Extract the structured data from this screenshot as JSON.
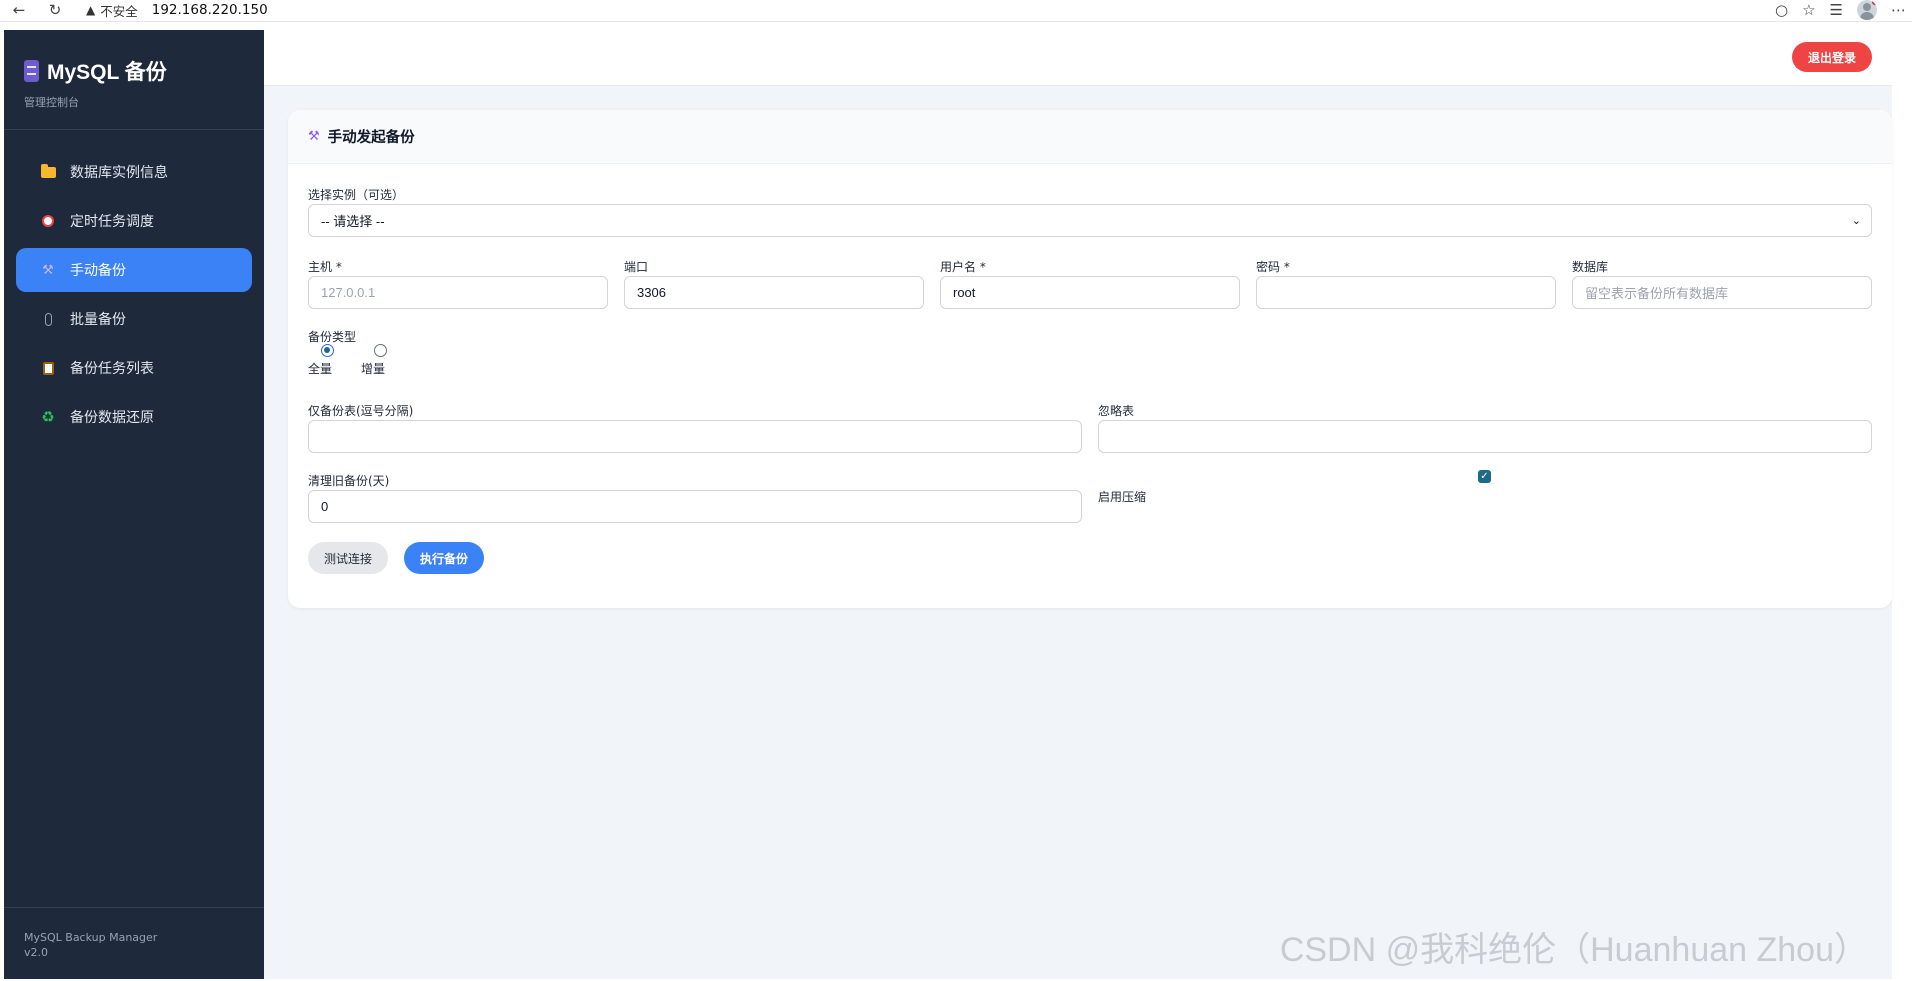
{
  "browser": {
    "insecure_label": "不安全",
    "url": "192.168.220.150"
  },
  "sidebar": {
    "brand_title": "MySQL 备份",
    "brand_subtitle": "管理控制台",
    "items": [
      {
        "label": "数据库实例信息",
        "icon": "folder-icon"
      },
      {
        "label": "定时任务调度",
        "icon": "alarm-clock-icon"
      },
      {
        "label": "手动备份",
        "icon": "tools-icon",
        "active": true
      },
      {
        "label": "批量备份",
        "icon": "paperclip-icon"
      },
      {
        "label": "备份任务列表",
        "icon": "clipboard-icon"
      },
      {
        "label": "备份数据还原",
        "icon": "recycle-icon"
      }
    ],
    "footer_name": "MySQL Backup Manager",
    "footer_version": "v2.0"
  },
  "topbar": {
    "logout_label": "退出登录"
  },
  "card": {
    "title": "手动发起备份"
  },
  "form": {
    "instance_label": "选择实例（可选）",
    "instance_value": "-- 请选择 --",
    "host_label": "主机 *",
    "host_placeholder": "127.0.0.1",
    "port_label": "端口",
    "port_value": "3306",
    "username_label": "用户名 *",
    "username_value": "root",
    "password_label": "密码 *",
    "password_value": "",
    "database_label": "数据库",
    "database_placeholder": "留空表示备份所有数据库",
    "backup_type_label": "备份类型",
    "backup_type_options": [
      "全量",
      "增量"
    ],
    "backup_type_selected": "全量",
    "only_tables_label": "仅备份表(逗号分隔)",
    "only_tables_value": "",
    "ignore_tables_label": "忽略表",
    "ignore_tables_value": "",
    "cleanup_label": "清理旧备份(天)",
    "cleanup_value": "0",
    "compress_label": "启用压缩",
    "compress_checked": true,
    "test_button": "测试连接",
    "run_button": "执行备份"
  },
  "watermark": "CSDN @我科绝伦（Huanhuan Zhou）"
}
